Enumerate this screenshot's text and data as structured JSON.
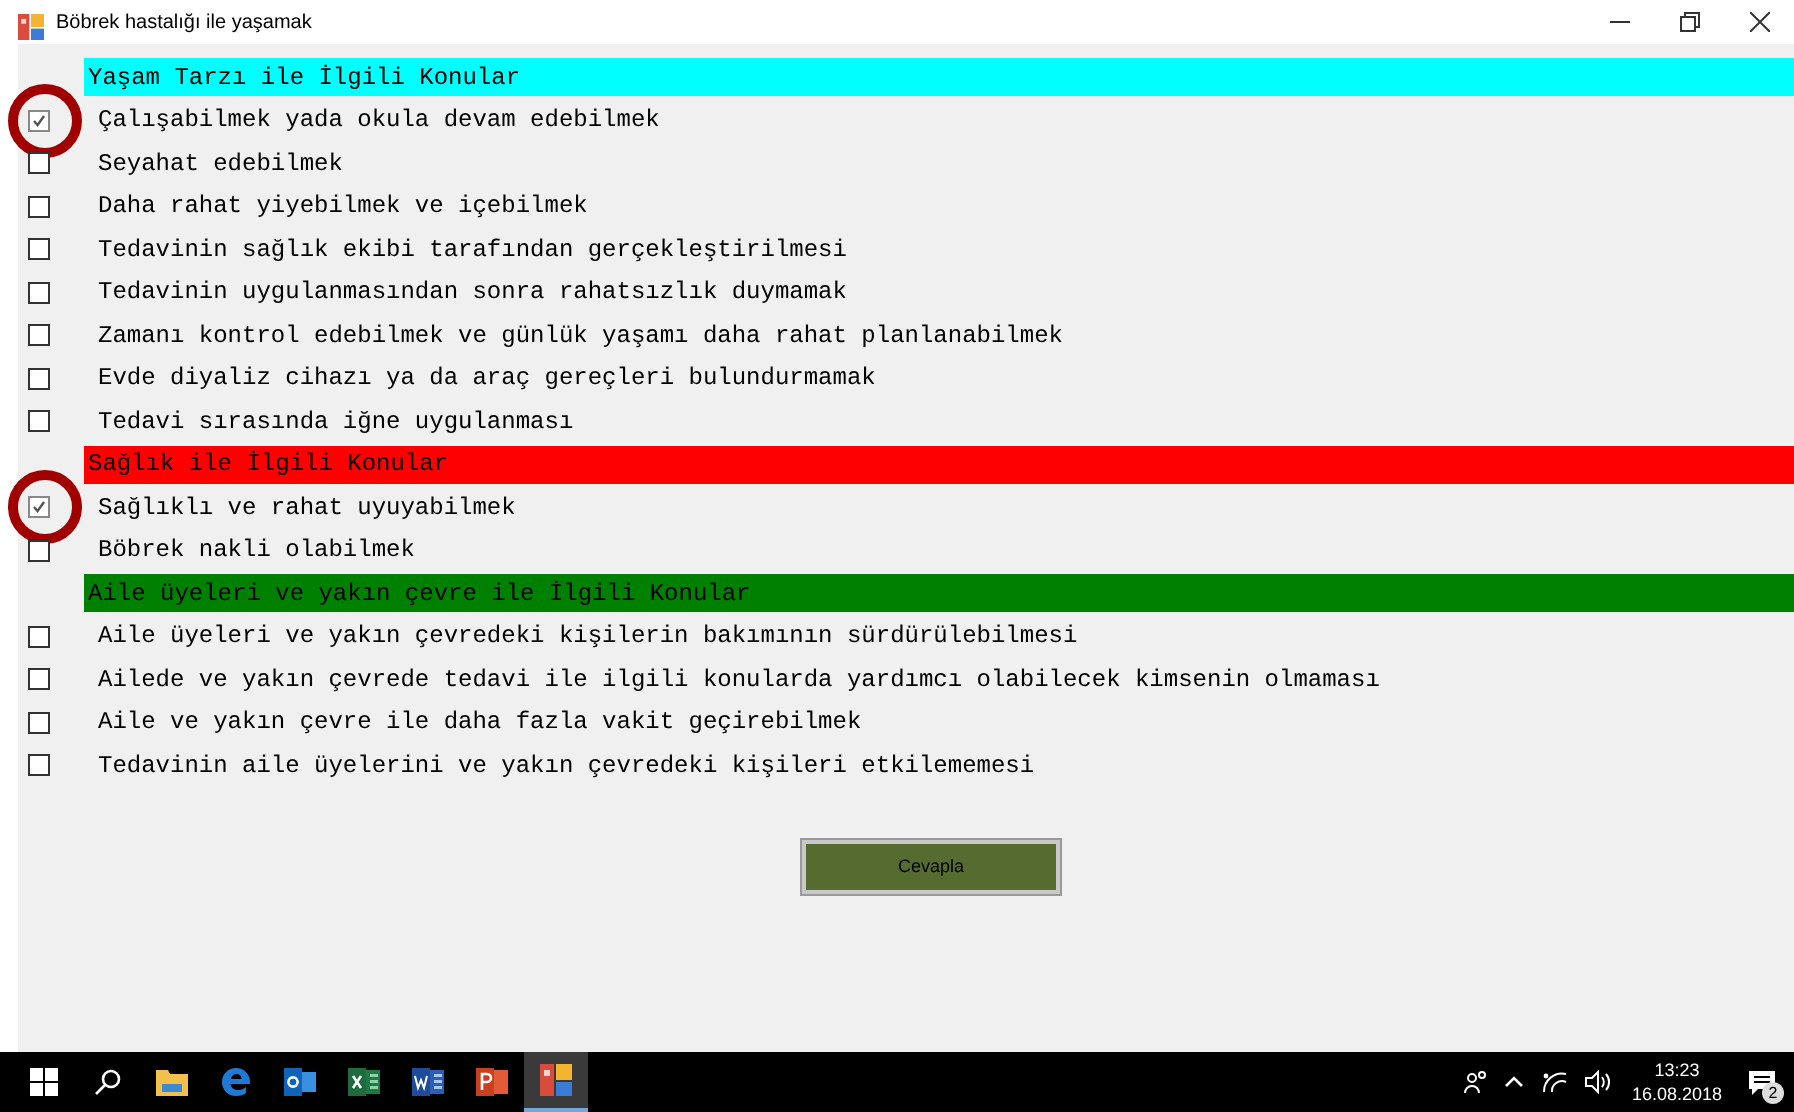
{
  "window": {
    "title": "Böbrek hastalığı ile yaşamak"
  },
  "sections": [
    {
      "title": "Yaşam Tarzı ile İlgili Konular",
      "color": "#00ffff",
      "items": [
        {
          "label": "Çalışabilmek yada okula devam edebilmek",
          "checked": true,
          "circled": true
        },
        {
          "label": "Seyahat edebilmek",
          "checked": false,
          "circled": false
        },
        {
          "label": "Daha rahat yiyebilmek ve içebilmek",
          "checked": false,
          "circled": false
        },
        {
          "label": "Tedavinin sağlık ekibi tarafından gerçekleştirilmesi",
          "checked": false,
          "circled": false
        },
        {
          "label": "Tedavinin uygulanmasından sonra rahatsızlık duymamak",
          "checked": false,
          "circled": false
        },
        {
          "label": "Zamanı kontrol edebilmek ve günlük yaşamı daha rahat planlanabilmek",
          "checked": false,
          "circled": false
        },
        {
          "label": "Evde diyaliz cihazı ya da araç gereçleri bulundurmamak",
          "checked": false,
          "circled": false
        },
        {
          "label": "Tedavi sırasında iğne uygulanması",
          "checked": false,
          "circled": false
        }
      ]
    },
    {
      "title": "Sağlık ile İlgili Konular",
      "color": "#ff0000",
      "items": [
        {
          "label": "Sağlıklı ve rahat uyuyabilmek",
          "checked": true,
          "circled": true
        },
        {
          "label": "Böbrek nakli olabilmek",
          "checked": false,
          "circled": false
        }
      ]
    },
    {
      "title": "Aile üyeleri ve yakın çevre ile İlgili Konular",
      "color": "#008000",
      "items": [
        {
          "label": "Aile üyeleri ve yakın çevredeki kişilerin bakımının sürdürülebilmesi",
          "checked": false,
          "circled": false
        },
        {
          "label": "Ailede ve yakın çevrede tedavi ile ilgili konularda yardımcı olabilecek kimsenin olmaması",
          "checked": false,
          "circled": false
        },
        {
          "label": "Aile ve yakın çevre ile daha fazla vakit geçirebilmek",
          "checked": false,
          "circled": false
        },
        {
          "label": "Tedavinin aile üyelerini ve yakın çevredeki kişileri etkilememesi",
          "checked": false,
          "circled": false
        }
      ]
    }
  ],
  "submit_button": "Cevapla",
  "taskbar": {
    "apps": [
      {
        "kind": "start",
        "active": false
      },
      {
        "kind": "search",
        "active": false
      },
      {
        "kind": "explorer",
        "active": false
      },
      {
        "kind": "edge",
        "active": false
      },
      {
        "kind": "outlook",
        "active": false
      },
      {
        "kind": "excel",
        "active": false
      },
      {
        "kind": "word",
        "active": false
      },
      {
        "kind": "powerpoint",
        "active": false
      },
      {
        "kind": "app",
        "active": true
      }
    ],
    "time": "13:23",
    "date": "16.08.2018",
    "notifications": "2"
  }
}
